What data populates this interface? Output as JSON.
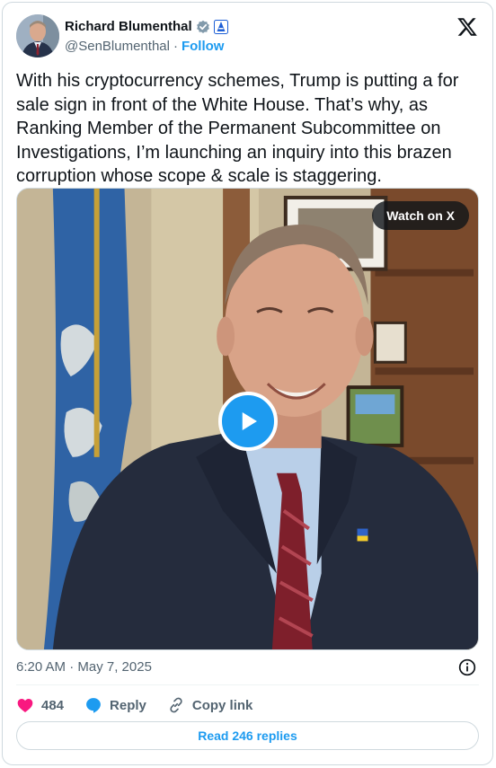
{
  "author": {
    "display_name": "Richard Blumenthal",
    "handle": "@SenBlumenthal",
    "follow_label": "Follow",
    "verified_badge_color": "#829aab",
    "affiliate_badge_color": "#1d5fd6"
  },
  "tweet": {
    "text": "With his cryptocurrency schemes, Trump is putting a for sale sign in front of the White House. That’s why, as Ranking Member of the Permanent Subcommittee on Investigations, I’m launching an inquiry into this brazen corruption whose scope & scale is staggering."
  },
  "media": {
    "watch_label": "Watch on X"
  },
  "meta": {
    "timestamp": "6:20 AM · May 7, 2025"
  },
  "actions": {
    "like_count": "484",
    "reply_label": "Reply",
    "copy_link_label": "Copy link"
  },
  "footer": {
    "read_replies_label": "Read 246 replies"
  },
  "colors": {
    "accent": "#1d9bf0",
    "like": "#f91880",
    "muted": "#536471",
    "border": "#cfd9de"
  },
  "icons": [
    "verified-badge-icon",
    "government-affiliate-icon",
    "x-logo-icon",
    "play-icon",
    "info-icon",
    "heart-icon",
    "reply-bubble-icon",
    "link-icon"
  ]
}
